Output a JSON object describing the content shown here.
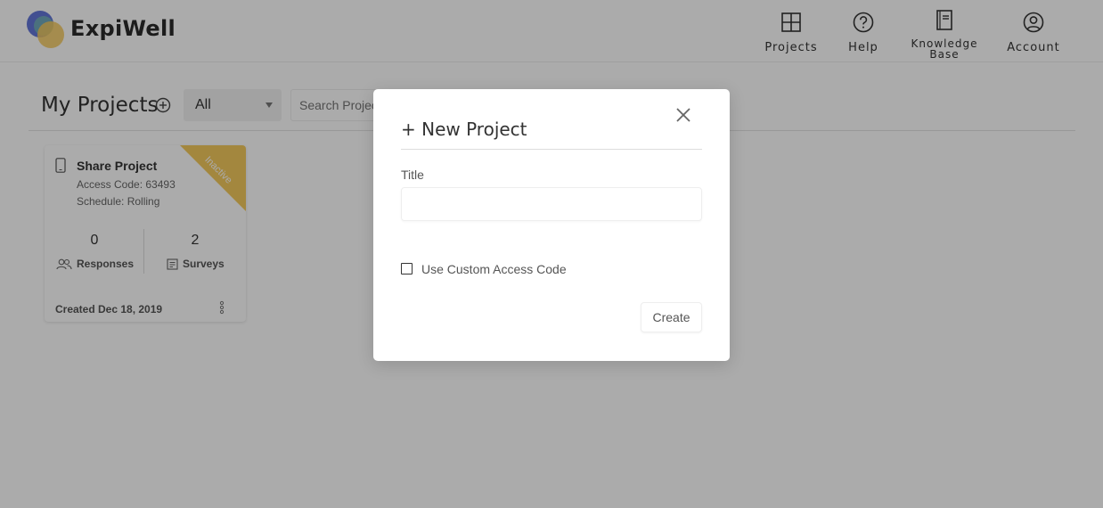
{
  "header": {
    "brand": "ExpiWell",
    "nav": {
      "projects": "Projects",
      "help": "Help",
      "knowledge_base_line1": "Knowledge",
      "knowledge_base_line2": "Base",
      "account": "Account"
    }
  },
  "main": {
    "title": "My Projects",
    "filter": {
      "selected": "All"
    },
    "search": {
      "placeholder": "Search Projects"
    }
  },
  "projects": [
    {
      "name": "Share Project",
      "access_code": "Access Code: 63493",
      "schedule": "Schedule: Rolling",
      "status": "Inactive",
      "responses_count": "0",
      "responses_label": "Responses",
      "surveys_count": "2",
      "surveys_label": "Surveys",
      "created": "Created Dec 18, 2019"
    }
  ],
  "modal": {
    "title": "+ New Project",
    "title_label": "Title",
    "title_value": "",
    "custom_code_label": "Use Custom Access Code",
    "create_label": "Create"
  },
  "colors": {
    "inactive_ribbon": "#f4c95d",
    "logo_blue": "#5b6fd6",
    "logo_yellow": "#f4c95d",
    "overlay": "rgba(0,0,0,0.33)"
  }
}
